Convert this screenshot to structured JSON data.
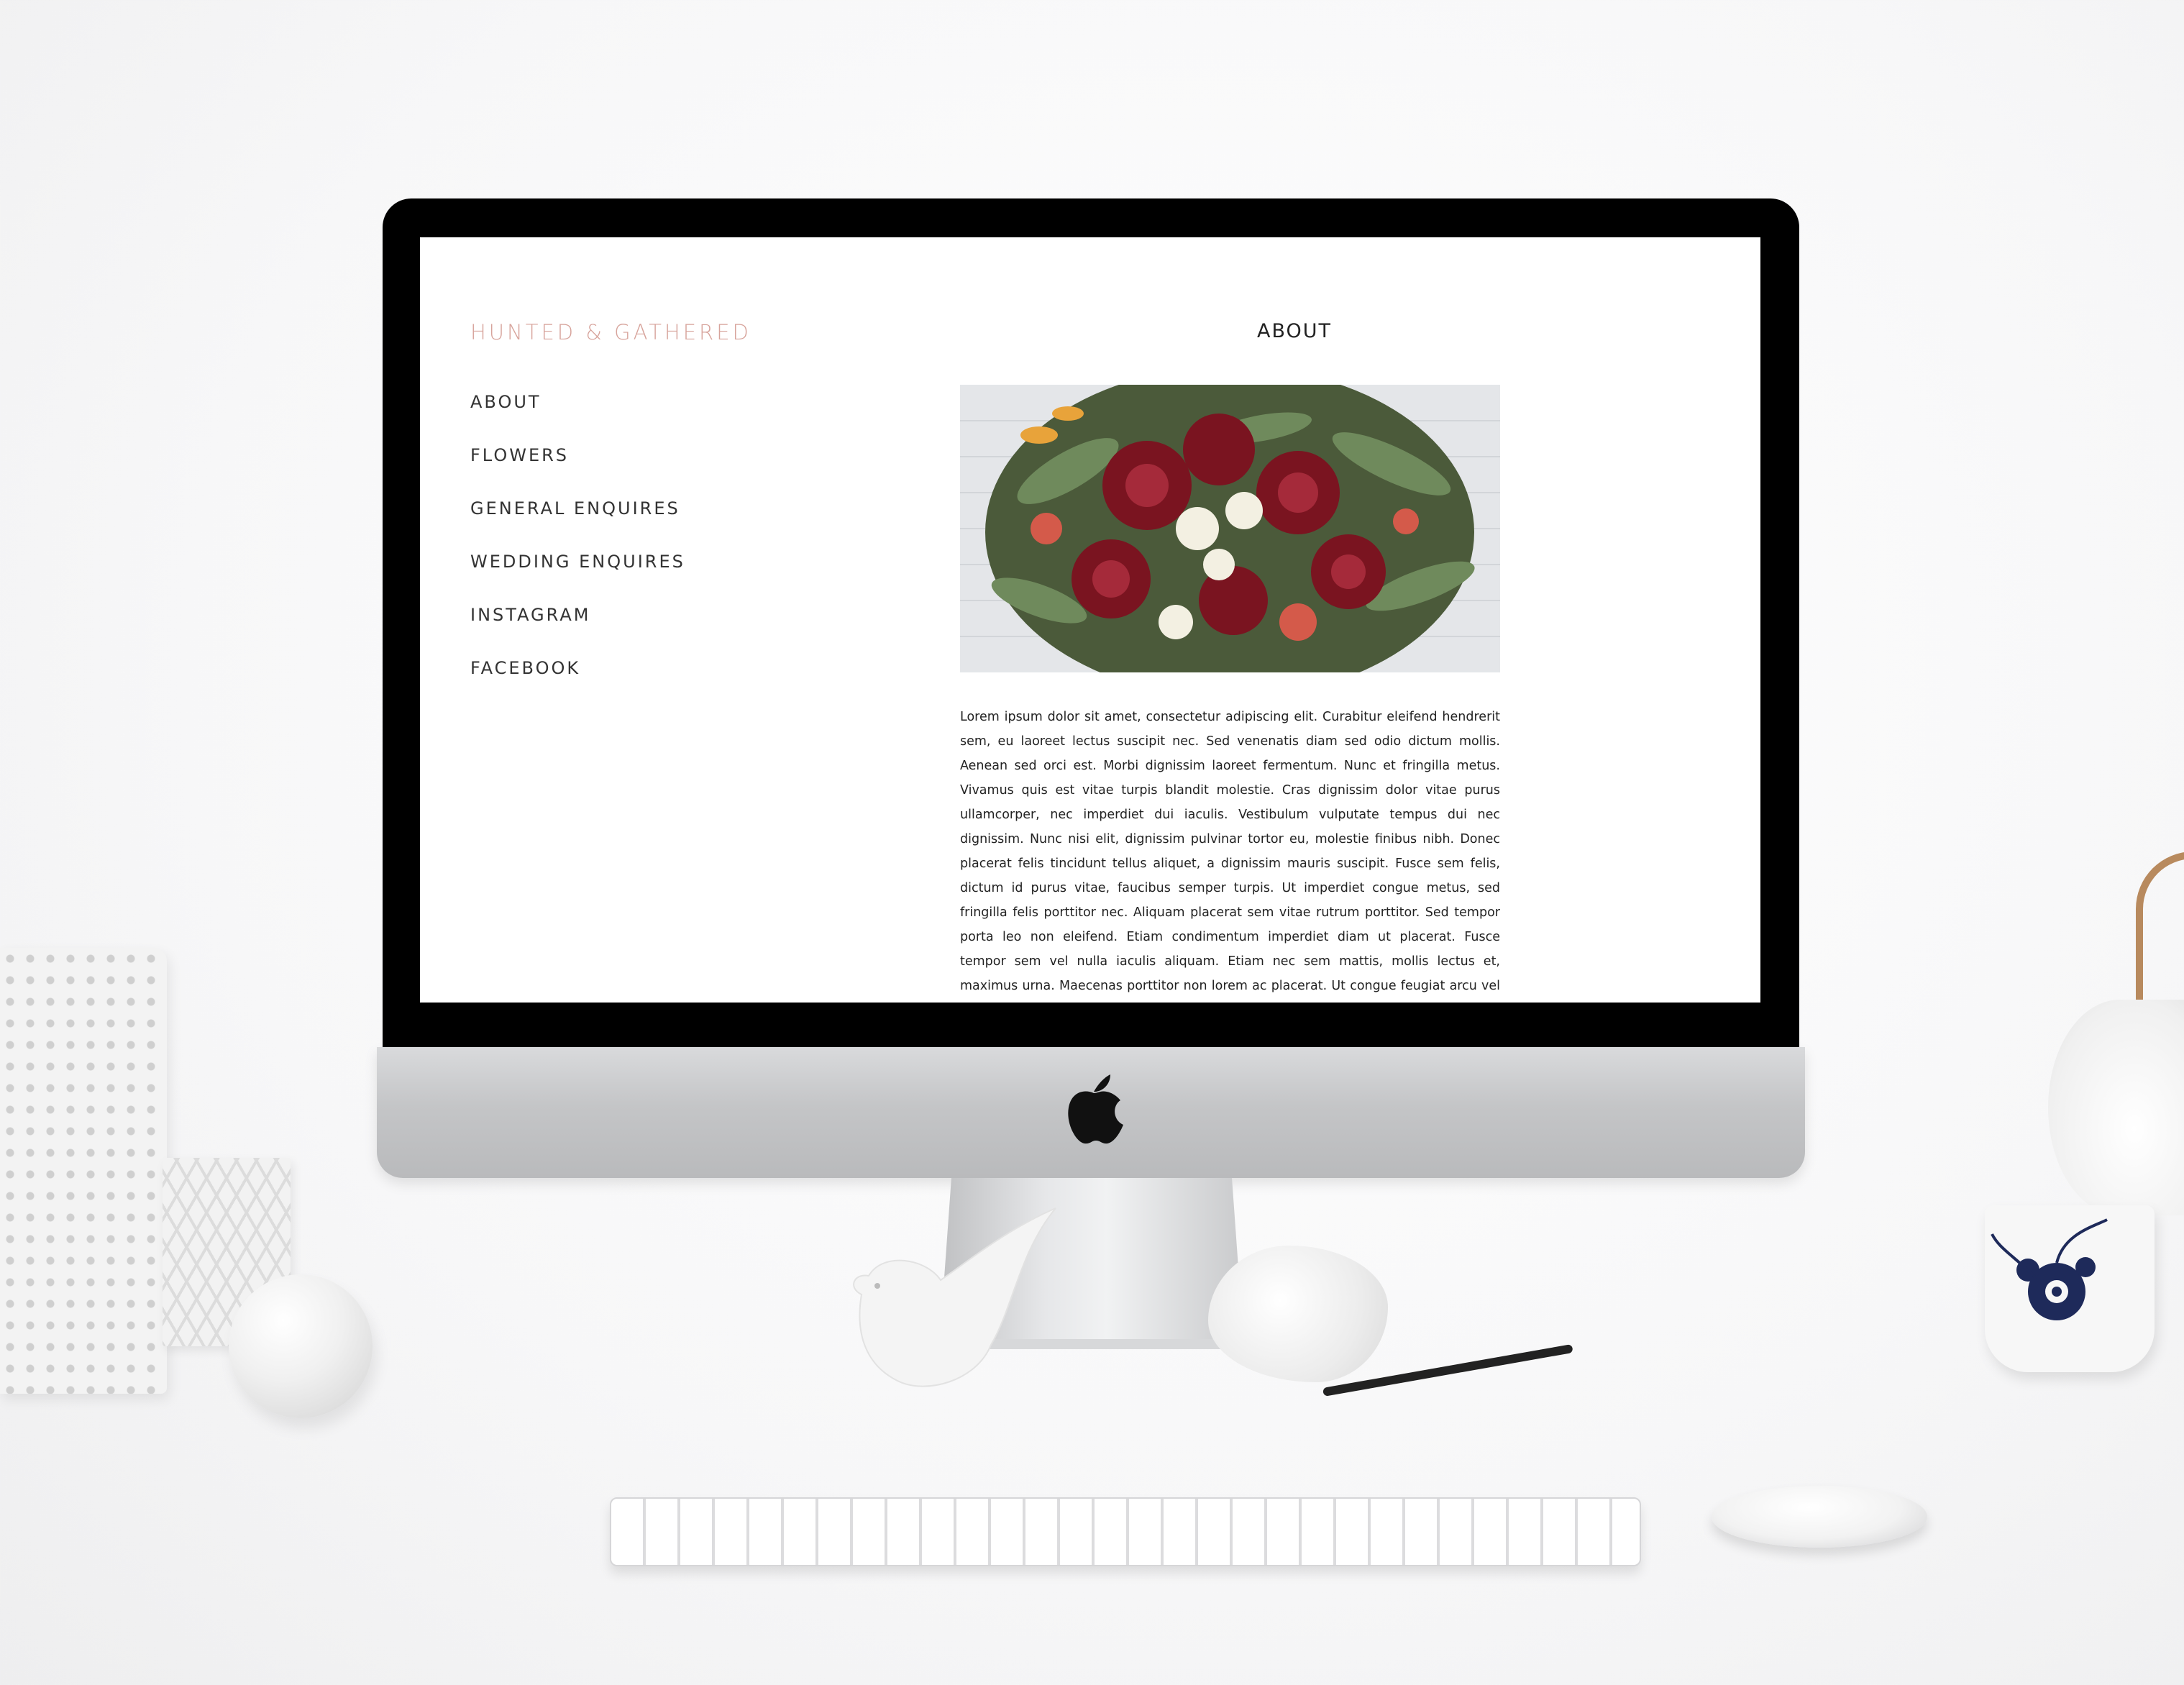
{
  "site": {
    "logo": "HUNTED & GATHERED",
    "nav": [
      "ABOUT",
      "FLOWERS",
      "GENERAL ENQUIRES",
      "WEDDING ENQUIRES",
      "INSTAGRAM",
      "FACEBOOK"
    ],
    "page_heading": "ABOUT",
    "body_text": "Lorem ipsum dolor sit amet, consectetur adipiscing elit. Curabitur eleifend hendrerit sem, eu laoreet lectus suscipit nec. Sed venenatis diam sed odio dictum mollis. Aenean sed orci est. Morbi dignissim laoreet fermentum. Nunc et fringilla metus. Vivamus quis est vitae turpis blandit molestie. Cras dignissim dolor vitae purus ullamcorper, nec imperdiet dui iaculis. Vestibulum vulputate tempus dui nec dignissim. Nunc nisi elit, dignissim pulvinar tortor eu, molestie finibus nibh. Donec placerat felis tincidunt tellus aliquet, a dignissim mauris suscipit. Fusce sem felis, dictum id purus vitae, faucibus semper turpis. Ut imperdiet congue metus, sed fringilla felis porttitor nec. Aliquam placerat sem vitae rutrum porttitor. Sed tempor porta leo non eleifend. Etiam condimentum imperdiet diam ut placerat. Fusce tempor sem vel nulla iaculis aliquam. Etiam nec sem mattis, mollis lectus et, maximus urna. Maecenas porttitor non lorem ac placerat. Ut congue feugiat arcu vel tincidunt. Suspendisse et sodales felis, at luctus lectus. Etiam vitae ante vitae lorem blandit laoreet eget eget ligula. Sed accumsan tortor nec",
    "hero_image": "flower-bouquet-photo"
  },
  "colors": {
    "logo": "#d7a39b",
    "nav_text": "#333333",
    "bezel": "#000000",
    "chin": "#c4c5c7",
    "page_background": "#ffffff"
  },
  "icons": {
    "computer_logo": "apple-logo-icon"
  }
}
